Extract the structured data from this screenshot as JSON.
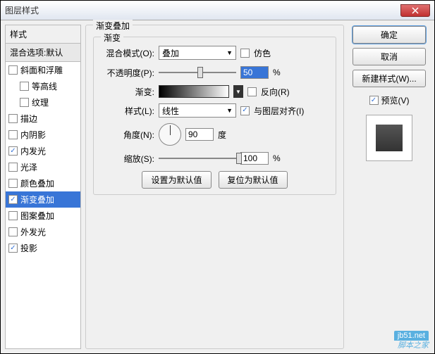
{
  "window": {
    "title": "图层样式"
  },
  "left": {
    "header": "样式",
    "sub": "混合选项:默认",
    "items": [
      {
        "label": "斜面和浮雕",
        "checked": false,
        "indent": false
      },
      {
        "label": "等高线",
        "checked": false,
        "indent": true
      },
      {
        "label": "纹理",
        "checked": false,
        "indent": true
      },
      {
        "label": "描边",
        "checked": false,
        "indent": false
      },
      {
        "label": "内阴影",
        "checked": false,
        "indent": false
      },
      {
        "label": "内发光",
        "checked": true,
        "indent": false
      },
      {
        "label": "光泽",
        "checked": false,
        "indent": false
      },
      {
        "label": "颜色叠加",
        "checked": false,
        "indent": false
      },
      {
        "label": "渐变叠加",
        "checked": true,
        "indent": false,
        "selected": true
      },
      {
        "label": "图案叠加",
        "checked": false,
        "indent": false
      },
      {
        "label": "外发光",
        "checked": false,
        "indent": false
      },
      {
        "label": "投影",
        "checked": true,
        "indent": false
      }
    ]
  },
  "panel": {
    "title": "渐变叠加",
    "inner_title": "渐变",
    "blend_label": "混合模式(O):",
    "blend_value": "叠加",
    "dither_label": "仿色",
    "opacity_label": "不透明度(P):",
    "opacity_value": "50",
    "percent": "%",
    "gradient_label": "渐变:",
    "reverse_label": "反向(R)",
    "style_label": "样式(L):",
    "style_value": "线性",
    "align_label": "与图层对齐(I)",
    "angle_label": "角度(N):",
    "angle_value": "90",
    "degree": "度",
    "scale_label": "缩放(S):",
    "scale_value": "100",
    "btn_default": "设置为默认值",
    "btn_reset": "复位为默认值"
  },
  "right": {
    "ok": "确定",
    "cancel": "取消",
    "new_style": "新建样式(W)...",
    "preview": "预览(V)"
  },
  "watermark": {
    "top": "jb51.net",
    "bottom": "脚本之家"
  }
}
